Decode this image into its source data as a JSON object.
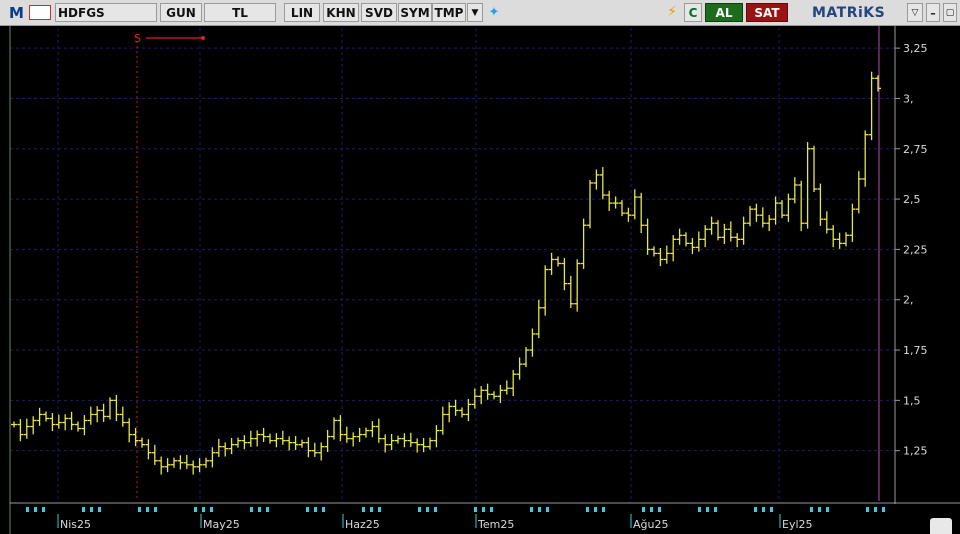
{
  "toolbar": {
    "app_logo": "M",
    "symbol": "HDFGS",
    "buttons": [
      "GUN",
      "TL",
      "LIN",
      "KHN",
      "SVD",
      "SYM",
      "TMP"
    ],
    "alert_label": "C",
    "buy_label": "AL",
    "sell_label": "SAT",
    "brand": "MATRiKS",
    "colors": {
      "buy": "#1d6b1d",
      "sell": "#9b1313",
      "brand": "#24457f"
    }
  },
  "marker": {
    "label": "S",
    "color": "#e02020"
  },
  "chart_data": {
    "type": "ohlc",
    "series_color": "#e6e645",
    "y_axis": {
      "side": "right",
      "min": 1.0,
      "max": 3.35,
      "ticks": [
        "1,25",
        "1,5",
        "1,75",
        "2,",
        "2,25",
        "2,5",
        "2,75",
        "3,",
        "3,25"
      ],
      "tick_values": [
        1.25,
        1.5,
        1.75,
        2.0,
        2.25,
        2.5,
        2.75,
        3.0,
        3.25
      ]
    },
    "x_axis": {
      "labels": [
        "Nis25",
        "May25",
        "Haz25",
        "Tem25",
        "Ağu25",
        "Eyl25"
      ]
    },
    "grid": true,
    "close": [
      1.38,
      1.33,
      1.37,
      1.4,
      1.43,
      1.41,
      1.38,
      1.39,
      1.41,
      1.38,
      1.36,
      1.4,
      1.43,
      1.45,
      1.42,
      1.5,
      1.43,
      1.39,
      1.33,
      1.3,
      1.28,
      1.24,
      1.2,
      1.17,
      1.18,
      1.2,
      1.19,
      1.18,
      1.17,
      1.18,
      1.2,
      1.24,
      1.27,
      1.26,
      1.28,
      1.3,
      1.29,
      1.31,
      1.33,
      1.32,
      1.3,
      1.31,
      1.3,
      1.29,
      1.28,
      1.29,
      1.25,
      1.24,
      1.27,
      1.32,
      1.4,
      1.33,
      1.31,
      1.32,
      1.33,
      1.35,
      1.37,
      1.31,
      1.28,
      1.3,
      1.31,
      1.3,
      1.29,
      1.28,
      1.27,
      1.3,
      1.35,
      1.43,
      1.47,
      1.45,
      1.43,
      1.48,
      1.52,
      1.55,
      1.53,
      1.52,
      1.55,
      1.56,
      1.63,
      1.68,
      1.75,
      1.83,
      1.96,
      2.15,
      2.2,
      2.18,
      2.08,
      1.98,
      2.18,
      2.37,
      2.58,
      2.62,
      2.52,
      2.48,
      2.48,
      2.43,
      2.42,
      2.51,
      2.37,
      2.25,
      2.23,
      2.2,
      2.23,
      2.3,
      2.32,
      2.28,
      2.26,
      2.3,
      2.35,
      2.38,
      2.31,
      2.35,
      2.31,
      2.3,
      2.38,
      2.45,
      2.42,
      2.38,
      2.4,
      2.48,
      2.42,
      2.5,
      2.57,
      2.38,
      2.75,
      2.55,
      2.4,
      2.35,
      2.3,
      2.28,
      2.32,
      2.45,
      2.6,
      2.82,
      3.1,
      3.05
    ]
  }
}
